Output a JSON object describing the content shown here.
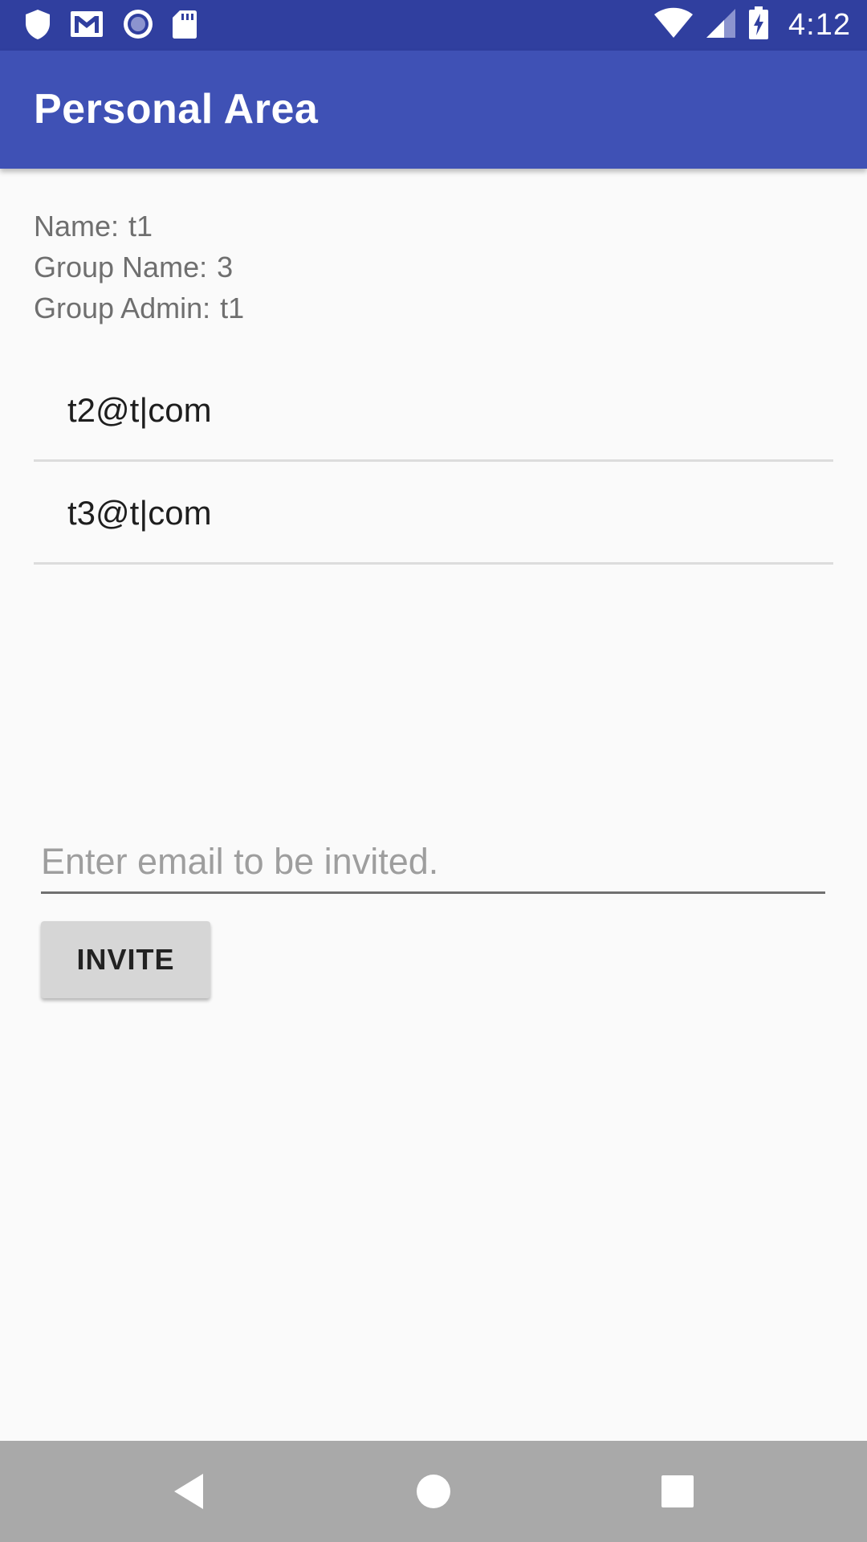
{
  "status_bar": {
    "time": "4:12",
    "left_icons": [
      "shield-icon",
      "gmail-icon",
      "circle-record-icon",
      "sd-card-icon"
    ],
    "right_icons": [
      "wifi-icon",
      "cell-signal-icon",
      "battery-charging-icon"
    ]
  },
  "app_bar": {
    "title": "Personal Area"
  },
  "info": {
    "name_label": "Name:",
    "name_value": "t1",
    "group_name_label": "Group Name:",
    "group_name_value": "3",
    "group_admin_label": "Group Admin:",
    "group_admin_value": "t1"
  },
  "members": [
    {
      "email": "t2@t|com"
    },
    {
      "email": "t3@t|com"
    }
  ],
  "invite": {
    "input_value": "",
    "placeholder": "Enter email to be invited.",
    "button_label": "INVITE"
  },
  "nav_bar": {
    "buttons": [
      "back-icon",
      "home-icon",
      "recents-icon"
    ]
  },
  "colors": {
    "status_bar": "#303f9f",
    "app_bar": "#3f51b5",
    "background": "#fafafa",
    "nav_bar": "#a9a9a9"
  }
}
